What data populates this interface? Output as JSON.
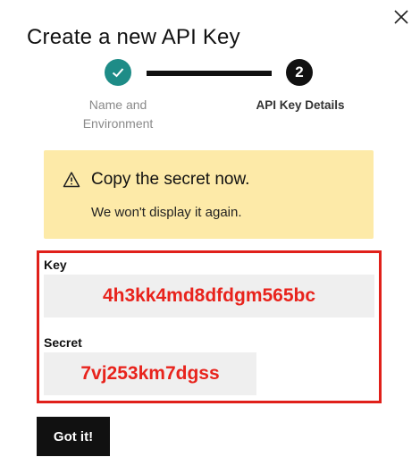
{
  "dialog": {
    "title": "Create a new API Key",
    "close_icon": "close-icon"
  },
  "stepper": {
    "steps": [
      {
        "label": "Name and Environment",
        "state": "completed",
        "icon": "checkmark-icon"
      },
      {
        "label": "API Key Details",
        "state": "current",
        "number": "2"
      }
    ],
    "completed_color": "#1e8c87",
    "current_color": "#111111"
  },
  "warning": {
    "icon": "warning-triangle-icon",
    "title": "Copy the secret now.",
    "message": "We won't display it again.",
    "background": "#fdeaa8"
  },
  "credentials": {
    "key_label": "Key",
    "key_value": "4h3kk4md8dfdgm565bc",
    "secret_label": "Secret",
    "secret_value": "7vj253km7dgss",
    "highlight_color": "#e0201a",
    "value_color": "#e8231c"
  },
  "actions": {
    "confirm_label": "Got it!"
  }
}
